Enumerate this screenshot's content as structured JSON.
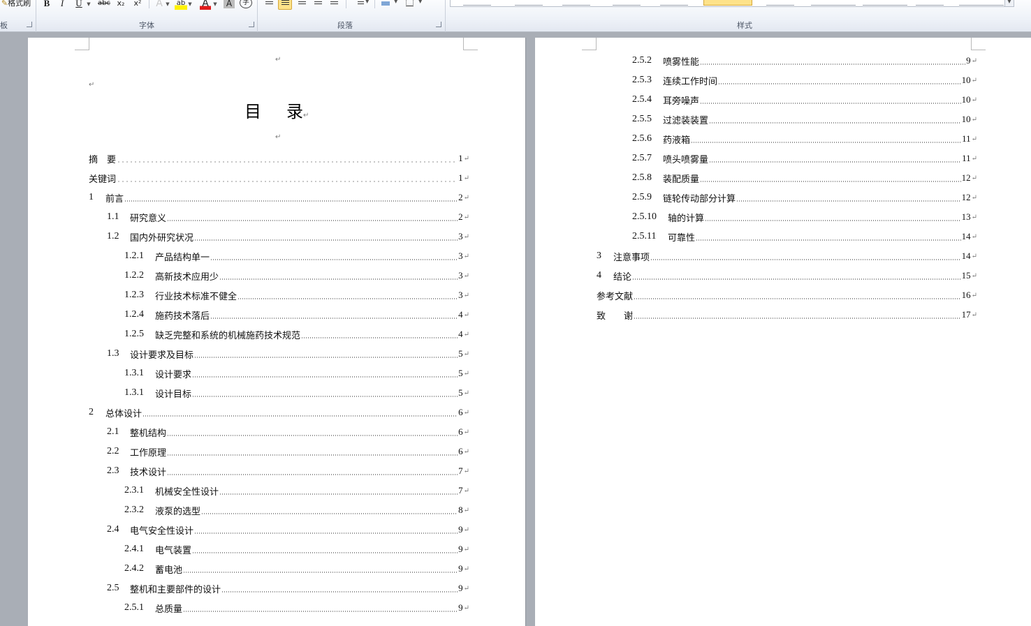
{
  "ribbon": {
    "clipboard": {
      "format_painter_label": "格式刷",
      "group_label_partial": "板"
    },
    "font": {
      "group_label": "字体",
      "bold": "B",
      "italic": "I",
      "underline": "U",
      "strikethrough": "abc",
      "subscript": "x₂",
      "superscript": "x²",
      "text_effects": "A",
      "highlight": "ab",
      "font_color": "A",
      "char_shading": "A",
      "enclose": "字"
    },
    "paragraph": {
      "group_label": "段落"
    },
    "styles": {
      "group_label": "样式"
    }
  },
  "document": {
    "paragraph_mark": "↵",
    "title": {
      "left": "目",
      "right": "录"
    },
    "page1": [
      {
        "num": "",
        "text": "摘　要",
        "page": "1",
        "level": 0,
        "dots": "wide"
      },
      {
        "num": "",
        "text": "关键词",
        "page": "1",
        "level": 0,
        "dots": "wide"
      },
      {
        "num": "1",
        "text": "前言",
        "page": "2",
        "level": 0
      },
      {
        "num": "1.1",
        "text": "研究意义",
        "page": "2",
        "level": 1
      },
      {
        "num": "1.2",
        "text": "国内外研究状况",
        "page": "3",
        "level": 1
      },
      {
        "num": "1.2.1",
        "text": "产品结构单一",
        "page": "3",
        "level": 2
      },
      {
        "num": "1.2.2",
        "text": "高新技术应用少",
        "page": "3",
        "level": 2
      },
      {
        "num": "1.2.3",
        "text": "行业技术标准不健全",
        "page": "3",
        "level": 2
      },
      {
        "num": "1.2.4",
        "text": "施药技术落后",
        "page": "4",
        "level": 2
      },
      {
        "num": "1.2.5",
        "text": "缺乏完整和系统的机械施药技术规范",
        "page": "4",
        "level": 2
      },
      {
        "num": "1.3",
        "text": "设计要求及目标",
        "page": "5",
        "level": 1
      },
      {
        "num": "1.3.1",
        "text": "设计要求",
        "page": "5",
        "level": 2
      },
      {
        "num": "1.3.1",
        "text": "设计目标",
        "page": "5",
        "level": 2
      },
      {
        "num": "2",
        "text": "总体设计",
        "page": "6",
        "level": 0
      },
      {
        "num": "2.1",
        "text": "整机结构",
        "page": "6",
        "level": 1
      },
      {
        "num": "2.2",
        "text": "工作原理",
        "page": "6",
        "level": 1
      },
      {
        "num": "2.3",
        "text": "技术设计",
        "page": "7",
        "level": 1
      },
      {
        "num": "2.3.1",
        "text": "机械安全性设计",
        "page": "7",
        "level": 2
      },
      {
        "num": "2.3.2",
        "text": "液泵的选型",
        "page": "8",
        "level": 2
      },
      {
        "num": "2.4",
        "text": "电气安全性设计",
        "page": "9",
        "level": 1
      },
      {
        "num": "2.4.1",
        "text": "电气装置",
        "page": "9",
        "level": 2
      },
      {
        "num": "2.4.2",
        "text": "蓄电池",
        "page": "9",
        "level": 2
      },
      {
        "num": "2.5",
        "text": "整机和主要部件的设计",
        "page": "9",
        "level": 1
      },
      {
        "num": "2.5.1",
        "text": "总质量",
        "page": "9",
        "level": 2
      }
    ],
    "page2": [
      {
        "num": "2.5.2",
        "text": "喷雾性能",
        "page": "9",
        "level": 2
      },
      {
        "num": "2.5.3",
        "text": "连续工作时间",
        "page": "10",
        "level": 2
      },
      {
        "num": "2.5.4",
        "text": "耳旁噪声",
        "page": "10",
        "level": 2
      },
      {
        "num": "2.5.5",
        "text": "过滤装装置",
        "page": "10",
        "level": 2
      },
      {
        "num": "2.5.6",
        "text": "药液箱",
        "page": "11",
        "level": 2
      },
      {
        "num": "2.5.7",
        "text": "喷头喷雾量",
        "page": "11",
        "level": 2
      },
      {
        "num": "2.5.8",
        "text": "装配质量",
        "page": "12",
        "level": 2
      },
      {
        "num": "2.5.9",
        "text": "链轮传动部分计算",
        "page": "12",
        "level": 2
      },
      {
        "num": "2.5.10",
        "text": "轴的计算",
        "page": "13",
        "level": 2
      },
      {
        "num": "2.5.11",
        "text": "可靠性",
        "page": "14",
        "level": 2
      },
      {
        "num": "3",
        "text": "注意事项",
        "page": "14",
        "level": 0
      },
      {
        "num": "4",
        "text": "结论",
        "page": "15",
        "level": 0
      },
      {
        "num": "",
        "text": "参考文献",
        "page": "16",
        "level": 0
      },
      {
        "num": "",
        "text": "致　　谢",
        "page": "17",
        "level": 0
      }
    ]
  }
}
